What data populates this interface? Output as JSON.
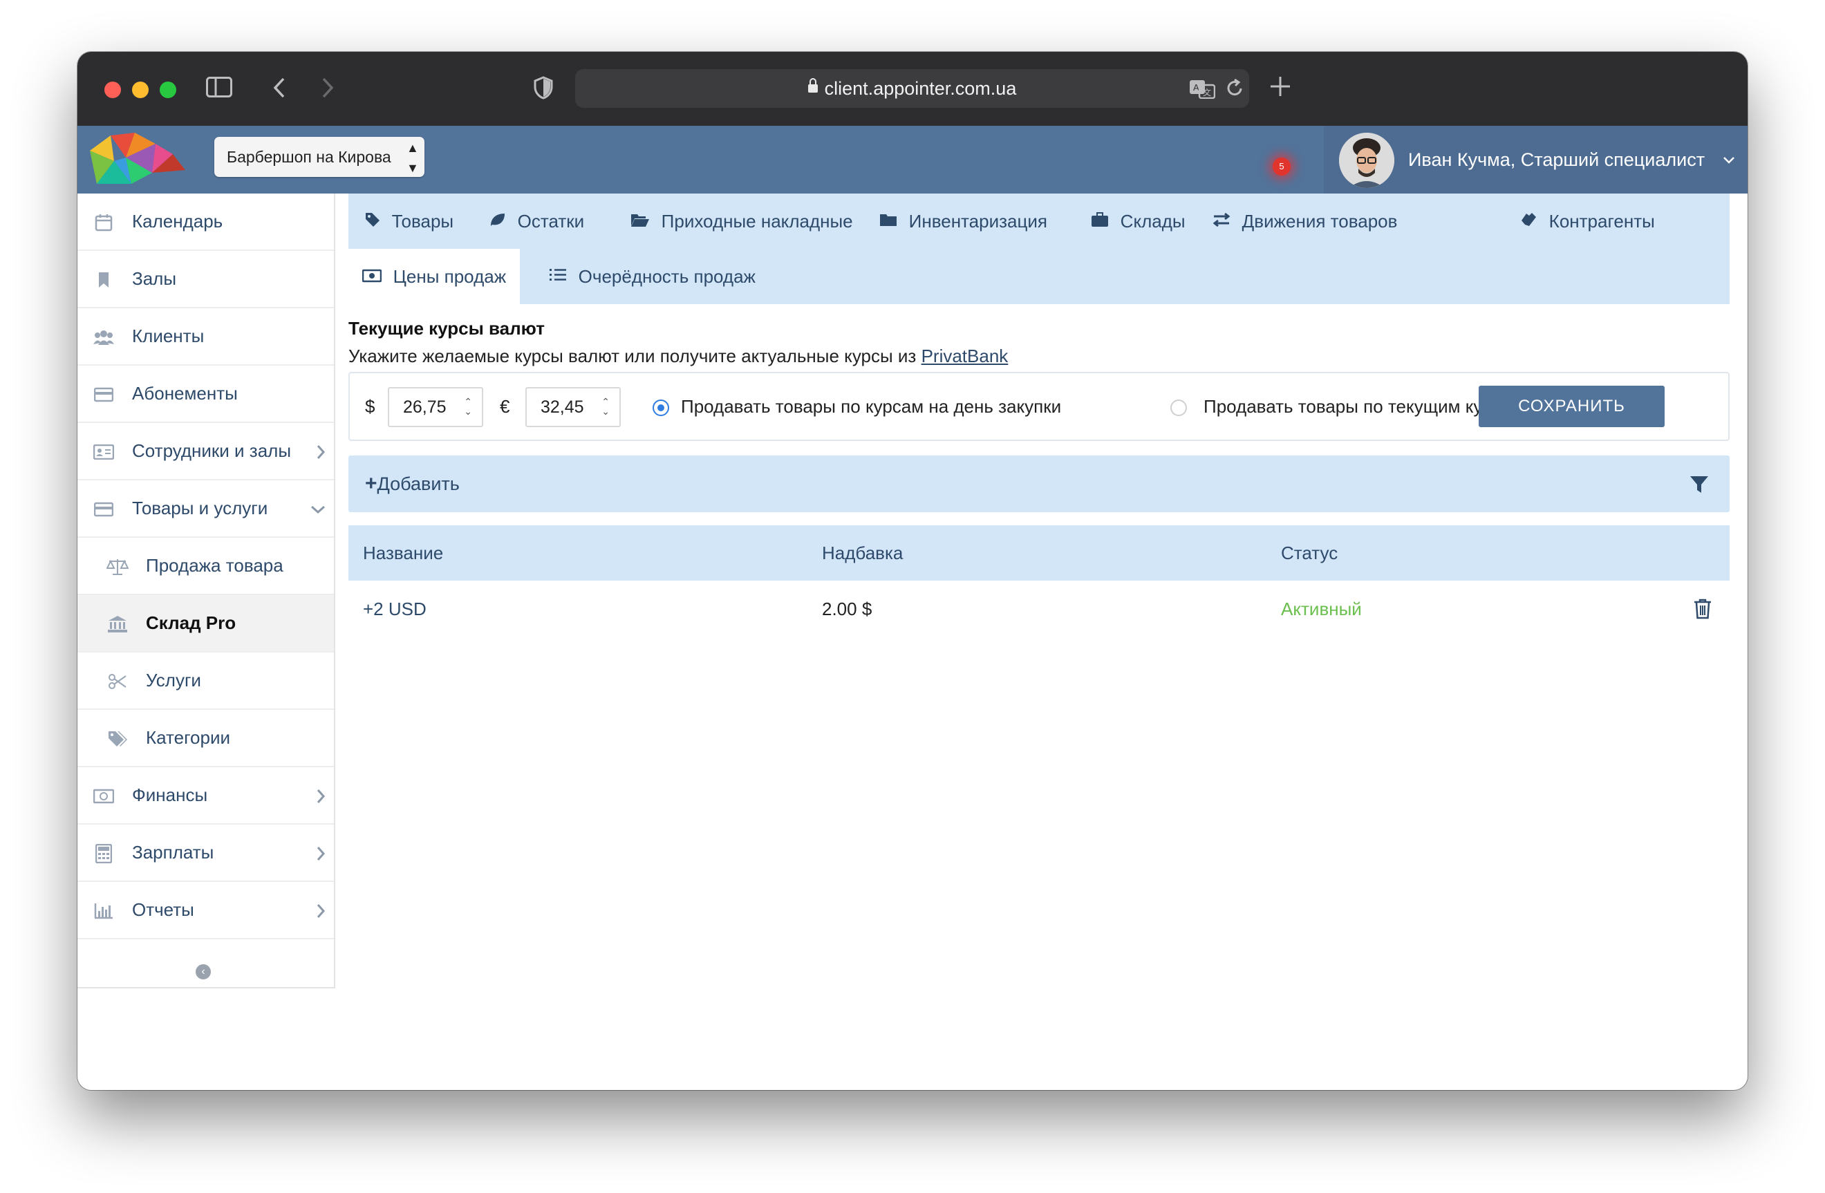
{
  "browser": {
    "url": "client.appointer.com.ua"
  },
  "header": {
    "branch": "Барбершоп на Кирова",
    "notifications_count": "5",
    "user_name": "Иван Кучма, Старший специалист"
  },
  "sidebar": {
    "items": [
      {
        "label": "Календарь",
        "icon": "calendar-icon"
      },
      {
        "label": "Залы",
        "icon": "bookmark-icon"
      },
      {
        "label": "Клиенты",
        "icon": "users-icon"
      },
      {
        "label": "Абонементы",
        "icon": "credit-card-icon"
      },
      {
        "label": "Сотрудники и залы",
        "icon": "id-card-icon",
        "expandable": true
      },
      {
        "label": "Товары и услуги",
        "icon": "credit-card-icon",
        "expanded": true
      },
      {
        "label": "Продажа товара",
        "icon": "scale-icon",
        "sub": true
      },
      {
        "label": "Склад Pro",
        "icon": "bank-icon",
        "sub": true,
        "active": true
      },
      {
        "label": "Услуги",
        "icon": "scissors-icon",
        "sub": true
      },
      {
        "label": "Категории",
        "icon": "tags-icon",
        "sub": true
      },
      {
        "label": "Финансы",
        "icon": "money-icon",
        "expandable": true
      },
      {
        "label": "Зарплаты",
        "icon": "calculator-icon",
        "expandable": true
      },
      {
        "label": "Отчеты",
        "icon": "bar-chart-icon",
        "expandable": true
      }
    ]
  },
  "tabs": [
    {
      "label": "Товары",
      "icon": "tag-icon"
    },
    {
      "label": "Остатки",
      "icon": "leaf-icon"
    },
    {
      "label": "Приходные накладные",
      "icon": "folder-open-icon"
    },
    {
      "label": "Инвентаризация",
      "icon": "folder-icon"
    },
    {
      "label": "Склады",
      "icon": "briefcase-icon"
    },
    {
      "label": "Движения товаров",
      "icon": "exchange-icon"
    },
    {
      "label": "Контрагенты",
      "icon": "handshake-icon"
    },
    {
      "label": "Цены продаж",
      "icon": "money-icon",
      "active": true
    },
    {
      "label": "Очерёдность продаж",
      "icon": "list-icon"
    }
  ],
  "rates": {
    "title": "Текущие курсы валют",
    "description": "Укажите желаемые курсы валют или получите актуальные курсы из ",
    "provider_link": "PrivatBank",
    "usd_symbol": "$",
    "usd_value": "26,75",
    "eur_symbol": "€",
    "eur_value": "32,45",
    "option_purchase": "Продавать товары по курсам на день закупки",
    "option_current": "Продавать товары по текущим курсам",
    "selected_option": "option_purchase",
    "save_label": "СОХРАНИТЬ"
  },
  "toolbar": {
    "add_label": "Добавить"
  },
  "table": {
    "columns": [
      "Название",
      "Надбавка",
      "Статус"
    ],
    "rows": [
      {
        "name": "+2 USD",
        "markup": "2.00 $",
        "status": "Активный"
      }
    ]
  },
  "colors": {
    "header_bg": "#52739a",
    "tab_bg": "#d3e6f8",
    "status_active": "#6bbf4e",
    "link": "#2e4a6a"
  }
}
